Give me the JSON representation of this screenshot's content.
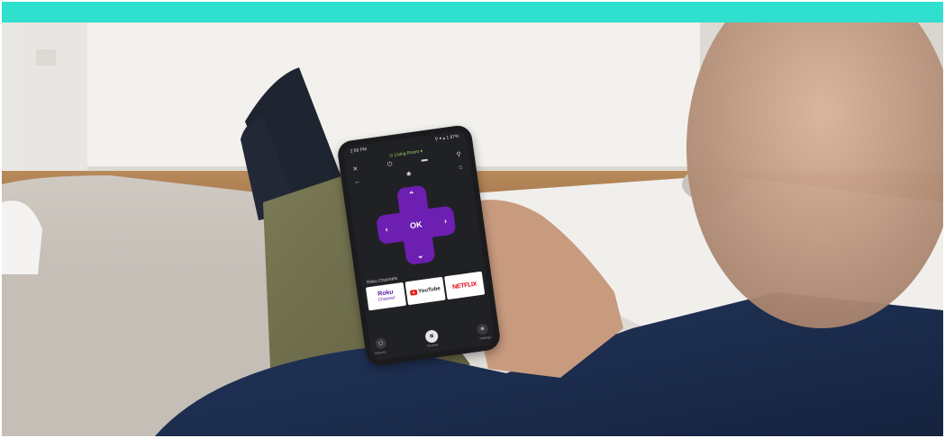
{
  "colors": {
    "band": "#2fe0cf",
    "remote_accent": "#6c1fb0"
  },
  "phone": {
    "status_time": "2:58 PM",
    "status_icons": "⚲ ▾ ▴ 1 87%",
    "device_name": "⊙ Living Room ▾",
    "icons": {
      "close": "close-icon",
      "power": "power-icon",
      "remote": "remote-icon",
      "search": "search-icon",
      "back": "back-icon",
      "asterisk": "options-icon",
      "home": "home-icon"
    },
    "dpad": {
      "ok_label": "OK",
      "up": "⌃",
      "down": "⌄",
      "left": "‹",
      "right": "›"
    },
    "channels_label": "Roku Channels",
    "channels": [
      {
        "line1": "Roku",
        "line2": "Channel"
      },
      {
        "label": "YouTube"
      },
      {
        "label": "NETFLIX"
      }
    ],
    "bottom_bar": [
      {
        "icon": "devices-icon",
        "label": "Devices"
      },
      {
        "icon": "remote-icon",
        "label": "Remote"
      },
      {
        "icon": "settings-icon",
        "label": "Settings"
      }
    ]
  }
}
